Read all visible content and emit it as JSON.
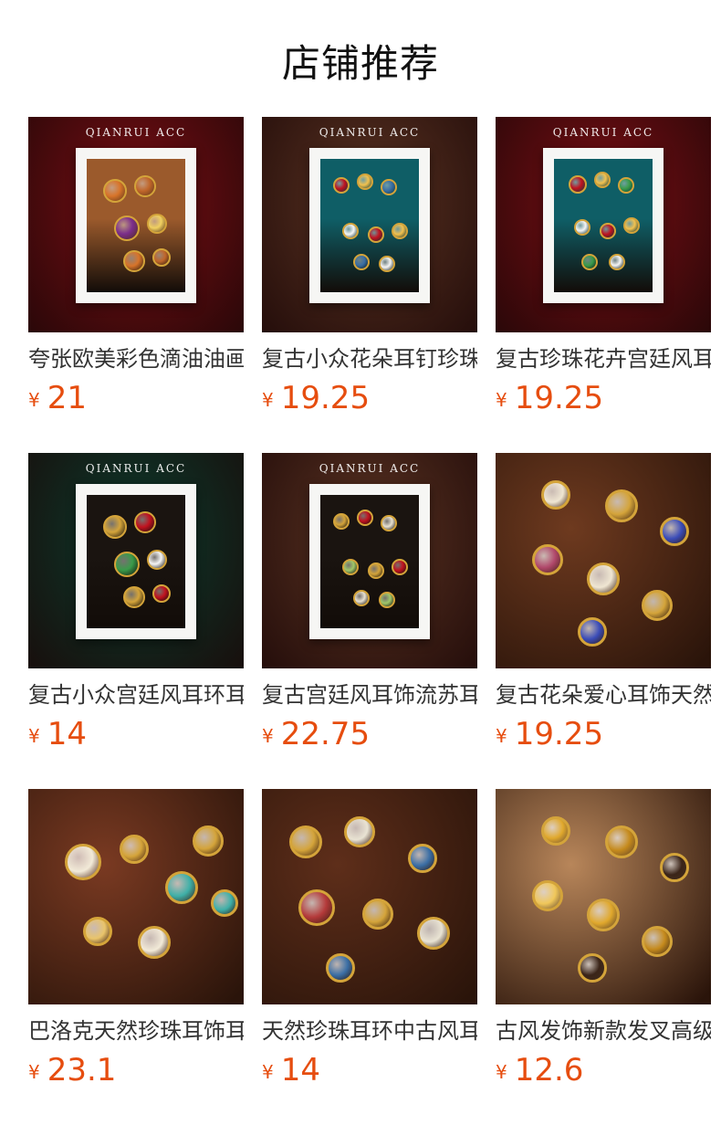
{
  "header": {
    "title": "店铺推荐"
  },
  "brand_text": "QIANRUI ACC",
  "currency_symbol": "¥",
  "products": [
    {
      "title": "夸张欧美彩色滴油油画",
      "price": "21",
      "background": "#7a0e14",
      "frame": true,
      "inner": "#9b5a2c",
      "accents": [
        "#d8742a",
        "#c0662a",
        "#7b2d8b",
        "#f0d060"
      ]
    },
    {
      "title": "复古小众花朵耳钉珍珠",
      "price": "19.25",
      "background": "#5a3322",
      "frame": true,
      "inner": "#0f5e66",
      "accents": [
        "#c1121f",
        "#f2c14e",
        "#3a6ea5",
        "#f5f5f5"
      ]
    },
    {
      "title": "复古珍珠花卉宫廷风耳",
      "price": "19.25",
      "background": "#7a0e14",
      "frame": true,
      "inner": "#0f5e66",
      "accents": [
        "#c1121f",
        "#f2c14e",
        "#3a9b4a",
        "#f5f5f5"
      ]
    },
    {
      "title": "复古小众宫廷风耳环耳",
      "price": "14",
      "background": "#0c3a2c",
      "frame": true,
      "inner": "#1a1410",
      "accents": [
        "#d4a43a",
        "#c1121f",
        "#3a9b4a",
        "#f5f5f5"
      ]
    },
    {
      "title": "复古宫廷风耳饰流苏耳",
      "price": "22.75",
      "background": "#5a3322",
      "frame": true,
      "inner": "#1a1410",
      "accents": [
        "#d4a43a",
        "#c1121f",
        "#e8e1d1",
        "#a0c86a"
      ]
    },
    {
      "title": "复古花朵爱心耳饰天然",
      "price": "19.25",
      "background": "#6e3a1f",
      "frame": false,
      "inner": "",
      "accents": [
        "#efe6d2",
        "#d4a43a",
        "#3a4cb8",
        "#b0476a"
      ]
    },
    {
      "title": "巴洛克天然珍珠耳饰耳",
      "price": "23.1",
      "background": "#7a3a22",
      "frame": false,
      "inner": "",
      "accents": [
        "#f2ead8",
        "#d4a43a",
        "#3fb0a8",
        "#e9c46a"
      ]
    },
    {
      "title": "天然珍珠耳环中古风耳",
      "price": "14",
      "background": "#5e2e1a",
      "frame": false,
      "inner": "",
      "accents": [
        "#d4a43a",
        "#e9e3d3",
        "#3a6ea5",
        "#b43a3a"
      ]
    },
    {
      "title": "古风发饰新款发叉高级",
      "price": "12.6",
      "background": "#b8865a",
      "frame": false,
      "inner": "",
      "accents": [
        "#e0a82c",
        "#c58a1c",
        "#3a2418",
        "#f0c75a"
      ]
    }
  ]
}
